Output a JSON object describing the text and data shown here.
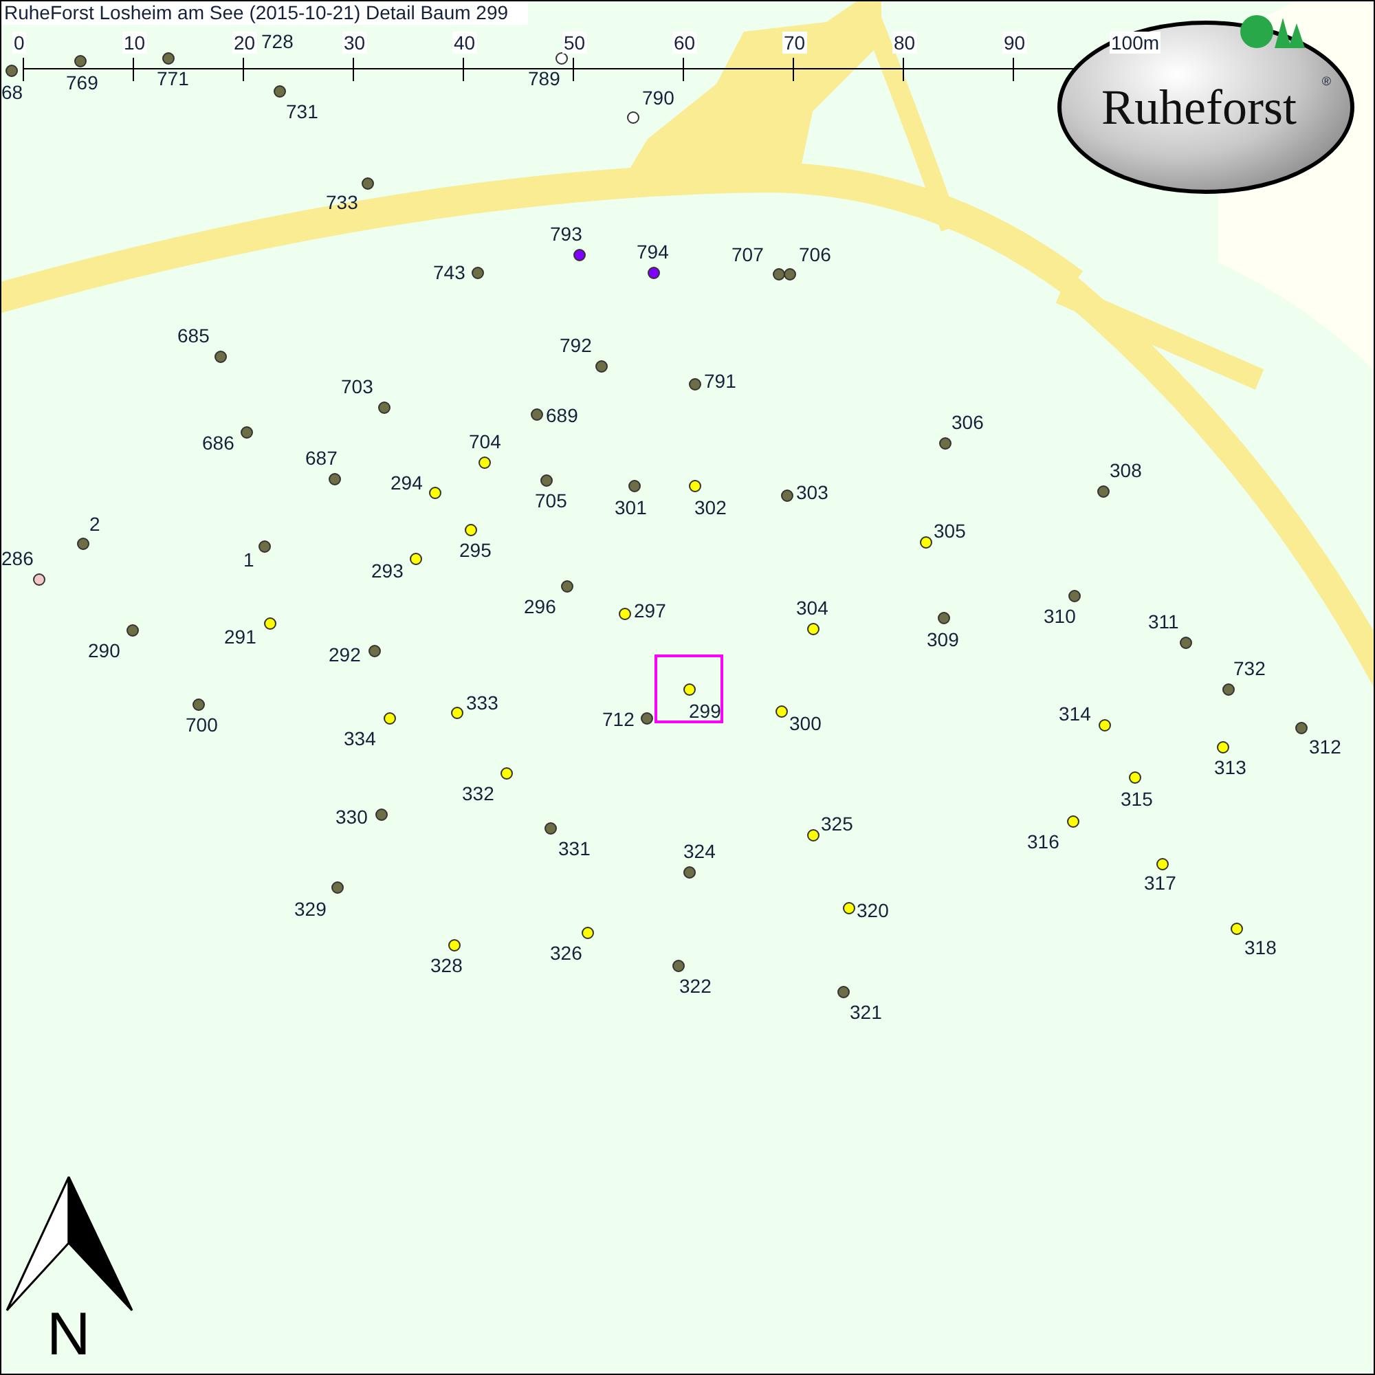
{
  "map": {
    "title": "RuheForst Losheim am See (2015-10-21) Detail  Baum 299",
    "scale_bar": {
      "ticks": [
        "0",
        "10",
        "20",
        "30",
        "40",
        "50",
        "60",
        "70",
        "80",
        "90",
        "100m"
      ]
    },
    "logo": {
      "text": "Ruheforst",
      "mark": "®"
    },
    "north_arrow": {
      "label": "N"
    },
    "trees": [
      {
        "label": "68",
        "color": "#6e6e46",
        "selected": false
      },
      {
        "label": "769",
        "color": "#6e6e46",
        "selected": false
      },
      {
        "label": "771",
        "color": "#6e6e46",
        "selected": false
      },
      {
        "label": "728",
        "selected": false
      },
      {
        "label": "731",
        "color": "#6e6e46",
        "selected": false
      },
      {
        "label": "789",
        "color": "#ffffff",
        "selected": false
      },
      {
        "label": "790",
        "color": "#ffffff",
        "selected": false
      },
      {
        "label": "733",
        "color": "#6e6e46",
        "selected": false
      },
      {
        "label": "793",
        "color": "#8000ff",
        "selected": false
      },
      {
        "label": "794",
        "color": "#8000ff",
        "selected": false
      },
      {
        "label": "743",
        "color": "#6e6e46",
        "selected": false
      },
      {
        "label": "707",
        "color": "#6e6e46",
        "selected": false
      },
      {
        "label": "706",
        "color": "#6e6e46",
        "selected": false
      },
      {
        "label": "685",
        "color": "#6e6e46",
        "selected": false
      },
      {
        "label": "792",
        "color": "#6e6e46",
        "selected": false
      },
      {
        "label": "791",
        "color": "#6e6e46",
        "selected": false
      },
      {
        "label": "703",
        "color": "#6e6e46",
        "selected": false
      },
      {
        "label": "689",
        "color": "#6e6e46",
        "selected": false
      },
      {
        "label": "686",
        "color": "#6e6e46",
        "selected": false
      },
      {
        "label": "704",
        "color": "#ffff00",
        "selected": false
      },
      {
        "label": "687",
        "color": "#6e6e46",
        "selected": false
      },
      {
        "label": "294",
        "color": "#ffff00",
        "selected": false
      },
      {
        "label": "705",
        "color": "#6e6e46",
        "selected": false
      },
      {
        "label": "301",
        "color": "#6e6e46",
        "selected": false
      },
      {
        "label": "302",
        "color": "#ffff00",
        "selected": false
      },
      {
        "label": "303",
        "color": "#6e6e46",
        "selected": false
      },
      {
        "label": "306",
        "color": "#6e6e46",
        "selected": false
      },
      {
        "label": "308",
        "color": "#6e6e46",
        "selected": false
      },
      {
        "label": "305",
        "color": "#ffff00",
        "selected": false
      },
      {
        "label": "2",
        "color": "#6e6e46",
        "selected": false
      },
      {
        "label": "286",
        "color": "#f2c8c8",
        "selected": false
      },
      {
        "label": "1",
        "color": "#6e6e46",
        "selected": false
      },
      {
        "label": "295",
        "color": "#ffff00",
        "selected": false
      },
      {
        "label": "293",
        "color": "#ffff00",
        "selected": false
      },
      {
        "label": "296",
        "color": "#6e6e46",
        "selected": false
      },
      {
        "label": "297",
        "color": "#ffff00",
        "selected": false
      },
      {
        "label": "304",
        "color": "#ffff00",
        "selected": false
      },
      {
        "label": "309",
        "color": "#6e6e46",
        "selected": false
      },
      {
        "label": "310",
        "color": "#6e6e46",
        "selected": false
      },
      {
        "label": "311",
        "color": "#6e6e46",
        "selected": false
      },
      {
        "label": "290",
        "color": "#6e6e46",
        "selected": false
      },
      {
        "label": "291",
        "color": "#ffff00",
        "selected": false
      },
      {
        "label": "292",
        "color": "#6e6e46",
        "selected": false
      },
      {
        "label": "732",
        "color": "#6e6e46",
        "selected": false
      },
      {
        "label": "700",
        "color": "#6e6e46",
        "selected": false
      },
      {
        "label": "333",
        "color": "#ffff00",
        "selected": false
      },
      {
        "label": "334",
        "color": "#ffff00",
        "selected": false
      },
      {
        "label": "712",
        "color": "#6e6e46",
        "selected": false
      },
      {
        "label": "299",
        "color": "#ffff00",
        "selected": true
      },
      {
        "label": "300",
        "color": "#ffff00",
        "selected": false
      },
      {
        "label": "314",
        "color": "#ffff00",
        "selected": false
      },
      {
        "label": "312",
        "color": "#6e6e46",
        "selected": false
      },
      {
        "label": "313",
        "color": "#ffff00",
        "selected": false
      },
      {
        "label": "315",
        "color": "#ffff00",
        "selected": false
      },
      {
        "label": "332",
        "color": "#ffff00",
        "selected": false
      },
      {
        "label": "330",
        "color": "#6e6e46",
        "selected": false
      },
      {
        "label": "331",
        "color": "#6e6e46",
        "selected": false
      },
      {
        "label": "325",
        "color": "#ffff00",
        "selected": false
      },
      {
        "label": "316",
        "color": "#ffff00",
        "selected": false
      },
      {
        "label": "324",
        "color": "#6e6e46",
        "selected": false
      },
      {
        "label": "317",
        "color": "#ffff00",
        "selected": false
      },
      {
        "label": "329",
        "color": "#6e6e46",
        "selected": false
      },
      {
        "label": "320",
        "color": "#ffff00",
        "selected": false
      },
      {
        "label": "318",
        "color": "#ffff00",
        "selected": false
      },
      {
        "label": "328",
        "color": "#ffff00",
        "selected": false
      },
      {
        "label": "326",
        "color": "#ffff00",
        "selected": false
      },
      {
        "label": "322",
        "color": "#6e6e46",
        "selected": false
      },
      {
        "label": "321",
        "color": "#6e6e46",
        "selected": false
      }
    ]
  }
}
